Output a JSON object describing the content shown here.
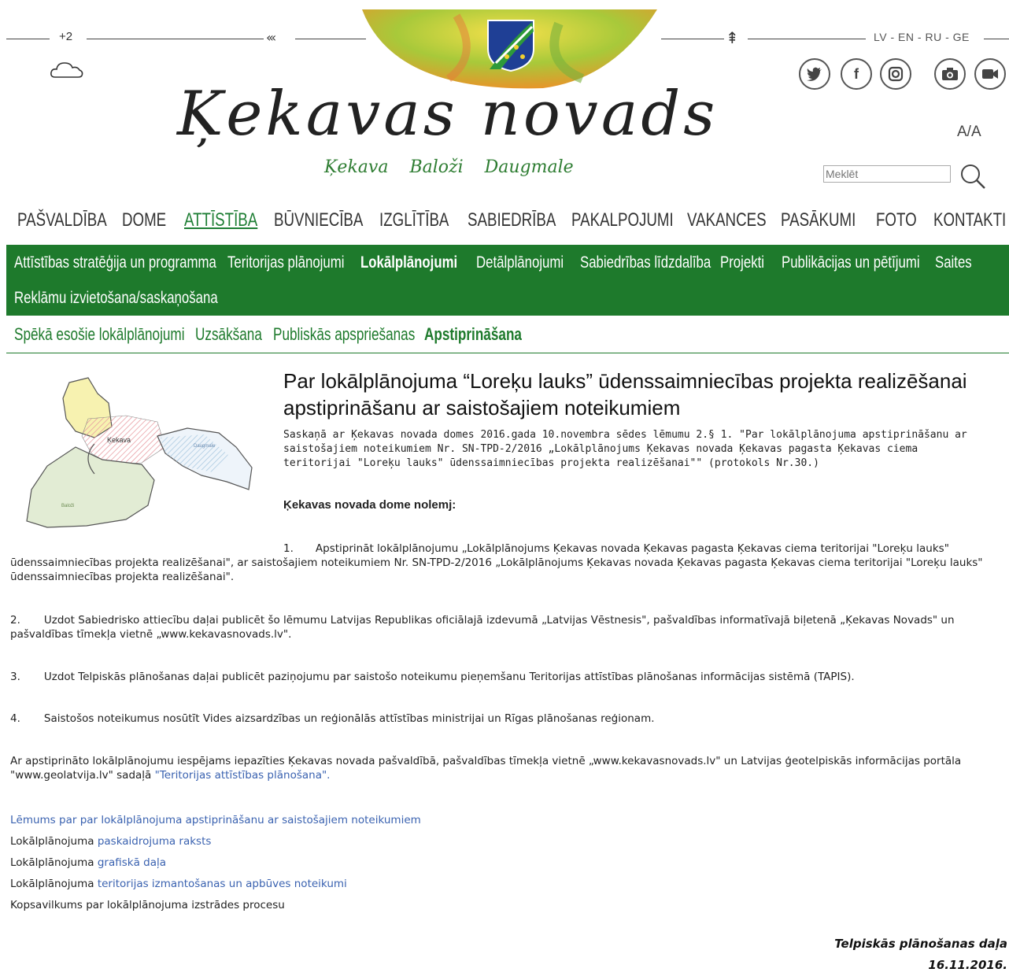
{
  "header": {
    "weather_temp": "+2",
    "weather_icon": "cloud-icon",
    "languages": [
      "LV",
      "EN",
      "RU",
      "GE"
    ],
    "lang_separator": "-",
    "social": [
      "twitter-icon",
      "facebook-icon",
      "instagram-icon",
      "camera-icon",
      "video-icon"
    ],
    "logo_title": "Ķekavas novads",
    "logo_subtitle": "Ķekava Baloži Daugmale",
    "font_size_toggle": "A/A",
    "search_placeholder": "Meklēt"
  },
  "main_nav": {
    "items": [
      "PAŠVALDĪBA",
      "DOME",
      "ATTĪSTĪBA",
      "BŪVNIECĪBA",
      "IZGLĪTĪBA",
      "SABIEDRĪBA",
      "PAKALPOJUMI",
      "VAKANCES",
      "PASĀKUMI",
      "FOTO",
      "KONTAKTI"
    ],
    "active": "ATTĪSTĪBA"
  },
  "section_nav": {
    "items": [
      "Attīstības stratēģija un programma",
      "Teritorijas plānojumi",
      "Lokālplānojumi",
      "Detālplānojumi",
      "Sabiedrības līdzdalība",
      "Projekti",
      "Publikācijas un pētījumi",
      "Saites",
      "Reklāmu izvietošana/saskaņošana"
    ],
    "active": "Lokālplānojumi"
  },
  "sub_nav": {
    "items": [
      "Spēkā esošie lokālplānojumi",
      "Uzsākšana",
      "Publiskās apspriešanas",
      "Apstiprināšana"
    ],
    "active": "Apstiprināšana"
  },
  "map": {
    "labels": [
      "Ķekava",
      "Daugmale",
      "Baloži"
    ]
  },
  "article": {
    "title": "Par lokālplānojuma “Loreķu lauks” ūdenssaimniecības projekta realizēšanai apstiprināšanu ar saistošajiem noteikumiem",
    "intro": "Saskaņā ar Ķekavas novada domes 2016.gada 10.novembra sēdes lēmumu 2.§ 1. \"Par lokālplānojuma apstiprināšanu ar saistošajiem noteikumiem Nr. SN-TPD-2/2016 „Lokālplānojums Ķekavas novada Ķekavas pagasta Ķekavas ciema teritorijai \"Loreķu lauks\" ūdenssaimniecības projekta realizēšanai\"\" (protokols Nr.30.)",
    "decision_heading": "Ķekavas novada dome nolemj:",
    "items": [
      {
        "num": "1.",
        "text": "Apstiprināt lokālplānojumu „Lokālplānojums Ķekavas novada Ķekavas pagasta Ķekavas ciema teritorijai \"Loreķu lauks\" ūdenssaimniecības projekta realizēšanai\", ar saistošajiem noteikumiem Nr. SN-TPD-2/2016 „Lokālplānojums Ķekavas novada Ķekavas pagasta Ķekavas ciema teritorijai \"Loreķu lauks\" ūdenssaimniecības projekta realizēšanai\"."
      },
      {
        "num": "2.",
        "text": "Uzdot Sabiedrisko attiecību daļai publicēt šo lēmumu Latvijas Republikas oficiālajā izdevumā „Latvijas Vēstnesis\", pašvaldības informatīvajā biļetenā „Ķekavas Novads\" un pašvaldības tīmekļa vietnē „www.kekavasnovads.lv\"."
      },
      {
        "num": "3.",
        "text": "Uzdot Telpiskās plānošanas daļai publicēt paziņojumu par saistošo noteikumu pieņemšanu Teritorijas attīstības plānošanas informācijas sistēmā (TAPIS)."
      },
      {
        "num": "4.",
        "text": "Saistošos noteikumus nosūtīt Vides aizsardzības un reģionālās attīstības ministrijai un Rīgas plānošanas reģionam."
      }
    ],
    "closing_text": "Ar apstiprināto lokālplānojumu iespējams iepazīties Ķekavas novada pašvaldībā, pašvaldības tīmekļa vietnē „www.kekavasnovads.lv\" un Latvijas ģeotelpiskās informācijas portāla \"www.geolatvija.lv\" sadaļā ",
    "closing_link": "\"Teritorijas attīstības plānošana\".",
    "doc_links": [
      {
        "prefix": "",
        "link": "Lēmums par par lokālplānojuma apstiprināšanu ar saistošajiem noteikumiem"
      },
      {
        "prefix": "Lokālplānojuma ",
        "link": "paskaidrojuma raksts"
      },
      {
        "prefix": "Lokālplānojuma ",
        "link": "grafiskā daļa"
      },
      {
        "prefix": "Lokālplānojuma ",
        "link": "teritorijas izmantošanas un apbūves noteikumi"
      },
      {
        "prefix": "Kopsavilkums par lokālplānojuma izstrādes procesu",
        "link": ""
      }
    ],
    "signature_dept": "Telpiskās plānošanas daļa",
    "signature_date": "16.11.2016."
  }
}
